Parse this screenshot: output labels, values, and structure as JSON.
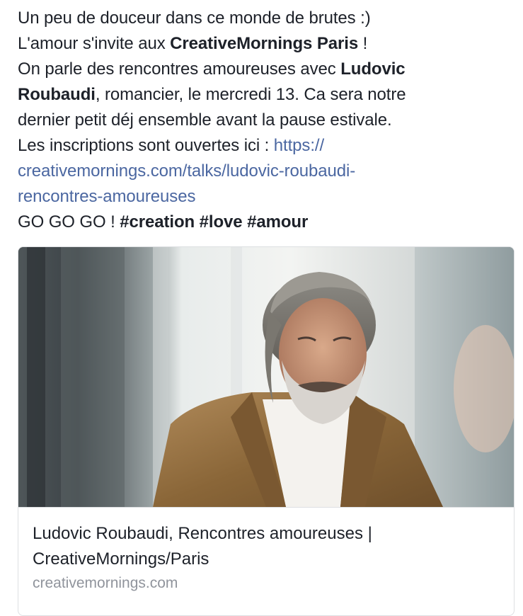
{
  "post": {
    "line1": "Un peu de douceur dans ce monde de brutes :)",
    "line2_prefix": "L'amour s'invite aux ",
    "line2_bold": "CreativeMornings Paris",
    "line2_suffix": " !",
    "line3_prefix": "On parle des rencontres amoureuses avec ",
    "line3_bold": "Ludovic",
    "line4_bold": "Roubaudi",
    "line4_suffix": ", romancier, le mercredi 13. Ca sera notre",
    "line5": "dernier petit déj ensemble avant la pause estivale.",
    "line6_prefix": "Les inscriptions sont ouvertes ici : ",
    "link_part1": "https://",
    "link_part2": "creativemornings.com/talks/ludovic-roubaudi-",
    "link_part3": "rencontres-amoureuses",
    "line9_prefix": "GO GO GO ! ",
    "hashtag1": "#creation",
    "hashtag2": "#love",
    "hashtag3": "#amour"
  },
  "link_card": {
    "title_line1": "Ludovic Roubaudi, Rencontres amoureuses |",
    "title_line2": "CreativeMornings/Paris",
    "domain": "creativemornings.com"
  },
  "colors": {
    "text": "#1d2129",
    "link": "#4b67a1",
    "muted": "#90949c",
    "border": "#dddfe2"
  }
}
